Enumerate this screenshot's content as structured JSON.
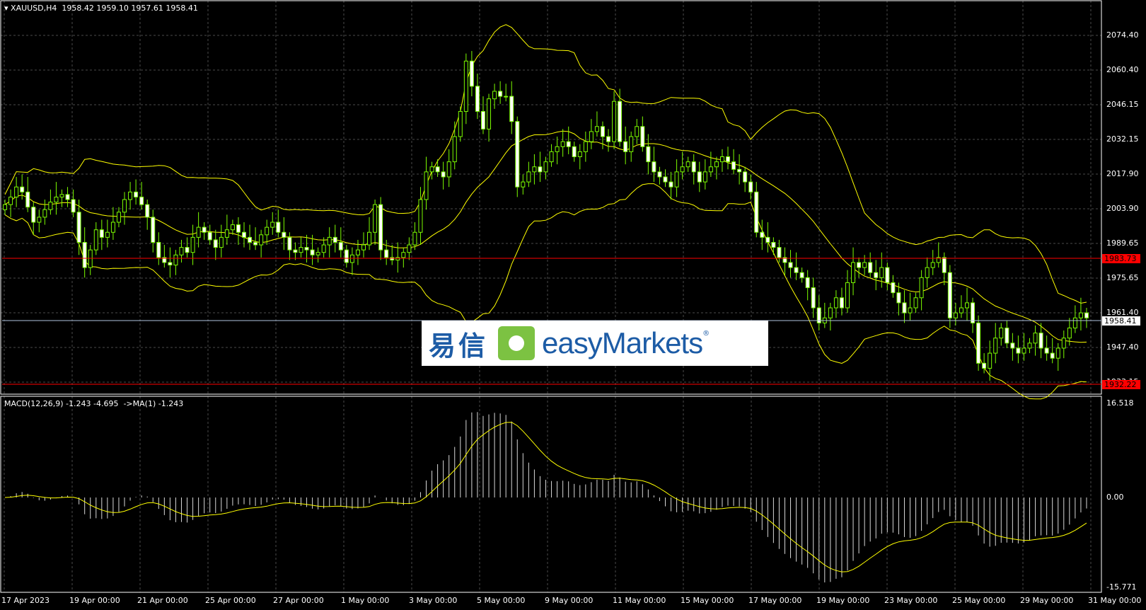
{
  "header": {
    "symbol_label": "XAUUSD,H4",
    "ohlc": "1958.42 1959.10 1957.61 1958.41"
  },
  "macd": {
    "label": "MACD(12,26,9) -1.243 -4.695  ->MA(1) -1.243",
    "axis": [
      "16.518",
      "0.00",
      "-15.771"
    ]
  },
  "price_axis": [
    "2074.40",
    "2060.40",
    "2046.15",
    "2032.15",
    "2017.90",
    "2003.90",
    "1989.65",
    "1975.65",
    "1961.40",
    "1947.40",
    "1933.15"
  ],
  "tags": {
    "upper_line": "1983.73",
    "current": "1958.41",
    "lower_line": "1932.22"
  },
  "time_axis": [
    "17 Apr 2023",
    "19 Apr 00:00",
    "21 Apr 00:00",
    "25 Apr 00:00",
    "27 Apr 00:00",
    "1 May 00:00",
    "3 May 00:00",
    "5 May 00:00",
    "9 May 00:00",
    "11 May 00:00",
    "15 May 00:00",
    "17 May 00:00",
    "19 May 00:00",
    "23 May 00:00",
    "25 May 00:00",
    "29 May 00:00",
    "31 May 00:00"
  ],
  "logo": {
    "cn": "易信",
    "en": "easyMarkets",
    "reg": "®"
  },
  "colors": {
    "background": "#000000",
    "candle": "#7cfc00",
    "band": "#ffff00",
    "level_line": "#ff0000",
    "current_line": "#b0c4de"
  },
  "chart_data": {
    "type": "candlestick",
    "timeframe": "H4",
    "ylim": [
      1928,
      2082
    ],
    "macd_ylim": [
      -15.771,
      16.518
    ],
    "close_series": [
      2003,
      2006,
      2010,
      2008,
      2002,
      1996,
      1998,
      2001,
      2004,
      2006,
      2007,
      2005,
      2000,
      1988,
      1978,
      1985,
      1993,
      1990,
      1992,
      1996,
      2000,
      2005,
      2008,
      2006,
      2003,
      1998,
      1988,
      1982,
      1980,
      1979,
      1983,
      1986,
      1984,
      1990,
      1994,
      1992,
      1989,
      1986,
      1990,
      1993,
      1995,
      1992,
      1990,
      1988,
      1987,
      1991,
      1994,
      1996,
      1992,
      1990,
      1985,
      1984,
      1986,
      1985,
      1983,
      1984,
      1987,
      1990,
      1988,
      1985,
      1980,
      1983,
      1985,
      1987,
      1992,
      2003,
      1985,
      1982,
      1981,
      1982,
      1984,
      1987,
      1992,
      2005,
      2016,
      2018,
      2016,
      2014,
      2020,
      2030,
      2040,
      2060,
      2050,
      2040,
      2033,
      2045,
      2048,
      2046,
      2046,
      2036,
      2010,
      2012,
      2016,
      2018,
      2016,
      2020,
      2024,
      2026,
      2028,
      2026,
      2022,
      2024,
      2028,
      2032,
      2034,
      2030,
      2028,
      2044,
      2028,
      2024,
      2030,
      2034,
      2026,
      2020,
      2016,
      2014,
      2012,
      2010,
      2016,
      2018,
      2020,
      2016,
      2012,
      2016,
      2018,
      2020,
      2022,
      2020,
      2017,
      2016,
      2012,
      2008,
      1992,
      1990,
      1988,
      1986,
      1982,
      1980,
      1978,
      1976,
      1974,
      1970,
      1962,
      1956,
      1958,
      1962,
      1966,
      1962,
      1972,
      1980,
      1978,
      1980,
      1976,
      1974,
      1978,
      1972,
      1968,
      1964,
      1960,
      1962,
      1966,
      1974,
      1978,
      1980,
      1982,
      1976,
      1958,
      1960,
      1962,
      1964,
      1956,
      1940,
      1938,
      1944,
      1950,
      1954,
      1948,
      1946,
      1944,
      1946,
      1948,
      1952,
      1946,
      1944,
      1942,
      1946,
      1950,
      1954,
      1958,
      1960,
      1958
    ]
  }
}
